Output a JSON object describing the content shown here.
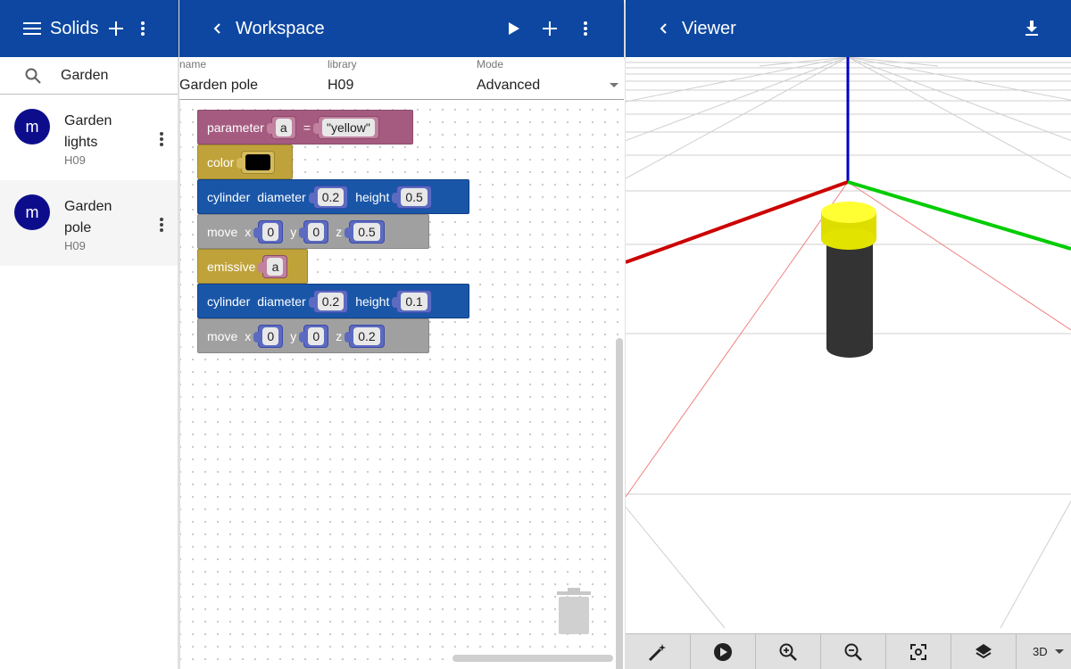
{
  "left_bar": {
    "title": "Solids",
    "menu_icon": "menu-icon",
    "add_icon": "plus-icon",
    "more_icon": "more-vert-icon"
  },
  "search": {
    "value": "Garden",
    "icon": "search-icon"
  },
  "solids": [
    {
      "avatar": "m",
      "title_line1": "Garden",
      "title_line2": "lights",
      "library": "H09",
      "selected": false
    },
    {
      "avatar": "m",
      "title_line1": "Garden",
      "title_line2": "pole",
      "library": "H09",
      "selected": true
    }
  ],
  "workspace_bar": {
    "title": "Workspace",
    "back_icon": "chevron-left-icon",
    "play_icon": "play-icon",
    "add_icon": "plus-icon",
    "more_icon": "more-vert-icon"
  },
  "meta": {
    "name_label": "name",
    "name_value": "Garden pole",
    "library_label": "library",
    "library_value": "H09",
    "mode_label": "Mode",
    "mode_value": "Advanced"
  },
  "blocks": {
    "parameter": {
      "label": "parameter",
      "name": "a",
      "eq": "=",
      "value": "\"yellow\""
    },
    "color1": {
      "label": "color",
      "swatch": "#000000"
    },
    "cylinder1": {
      "label": "cylinder",
      "diameter_label": "diameter",
      "diameter": "0.2",
      "height_label": "height",
      "height": "0.5"
    },
    "move1": {
      "label": "move",
      "x_label": "x",
      "x": "0",
      "y_label": "y",
      "y": "0",
      "z_label": "z",
      "z": "0.5"
    },
    "emissive": {
      "label": "emissive",
      "value": "a"
    },
    "cylinder2": {
      "label": "cylinder",
      "diameter_label": "diameter",
      "diameter": "0.2",
      "height_label": "height",
      "height": "0.1"
    },
    "move2": {
      "label": "move",
      "x_label": "x",
      "x": "0",
      "y_label": "y",
      "y": "0",
      "z_label": "z",
      "z": "0.2"
    }
  },
  "viewer_bar": {
    "title": "Viewer",
    "back_icon": "chevron-left-icon",
    "download_icon": "download-icon"
  },
  "viewer_toolbar": {
    "buttons": [
      "magic-wand-icon",
      "play-circle-icon",
      "zoom-in-icon",
      "zoom-out-icon",
      "center-focus-icon",
      "layers-icon"
    ],
    "view_mode": "3D"
  },
  "colors": {
    "app_bar": "#0d47a1",
    "avatar": "#0d0d8c",
    "axis_x": "#cc0000",
    "axis_y": "#00cc00",
    "axis_z": "#0000cc",
    "pole": "#333333",
    "lamp": "#ffff00"
  }
}
